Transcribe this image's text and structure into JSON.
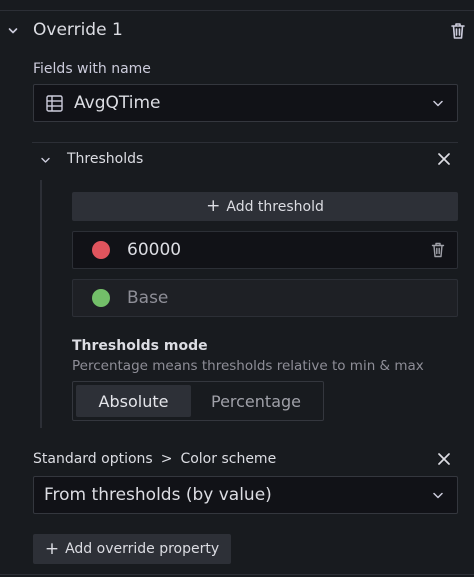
{
  "override": {
    "title": "Override 1",
    "matcher_label": "Fields with name",
    "matcher_value": "AvgQTime"
  },
  "thresholds": {
    "title": "Thresholds",
    "add_label": "Add threshold",
    "steps": [
      {
        "value": "60000",
        "color": "#e0545d"
      },
      {
        "value": "Base",
        "color": "#73bf69"
      }
    ],
    "mode_label": "Thresholds mode",
    "mode_description": "Percentage means thresholds relative to min & max",
    "modes": [
      "Absolute",
      "Percentage"
    ],
    "selected_mode": "Absolute"
  },
  "color_scheme": {
    "category": "Standard options",
    "separator": ">",
    "property": "Color scheme",
    "value": "From thresholds (by value)"
  },
  "add_override_property": "Add override property",
  "icons": {
    "collapse": "chevron-down-icon",
    "delete": "trash-icon",
    "field": "field-grid-icon",
    "remove": "close-icon",
    "add": "plus-icon"
  }
}
